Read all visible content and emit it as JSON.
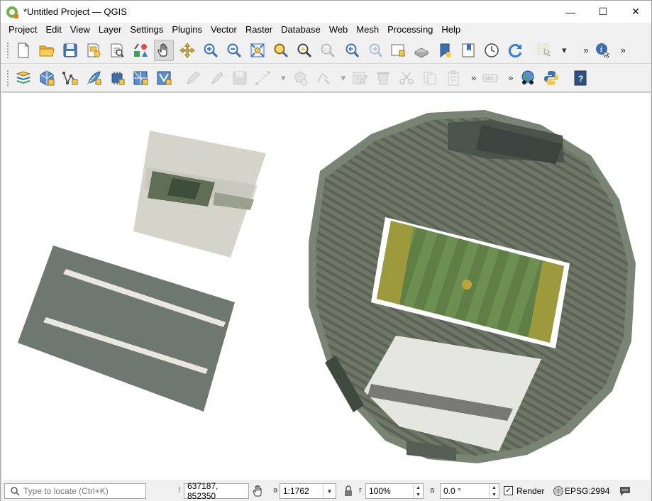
{
  "window": {
    "title": "*Untitled Project — QGIS",
    "controls": {
      "minimize": "—",
      "maximize": "☐",
      "close": "✕"
    }
  },
  "menu": [
    "Project",
    "Edit",
    "View",
    "Layer",
    "Settings",
    "Plugins",
    "Vector",
    "Raster",
    "Database",
    "Web",
    "Mesh",
    "Processing",
    "Help"
  ],
  "toolbar1": {
    "tools": [
      "new-project",
      "open-project",
      "save-project",
      "print-layout",
      "layout-manager",
      "style-manager",
      "pan",
      "pan-to-selection",
      "zoom-in",
      "zoom-out",
      "zoom-full",
      "zoom-to-selection",
      "zoom-to-layer",
      "zoom-native",
      "zoom-last",
      "zoom-next",
      "new-bookmark",
      "show-bookmarks",
      "temporal-controller",
      "refresh",
      "select-features",
      "identify"
    ],
    "active": "pan",
    "overflow": "»"
  },
  "toolbar2": {
    "tools": [
      "data-source-manager",
      "new-geopackage-layer",
      "new-shapefile-layer",
      "new-spatialite-layer",
      "new-virtual-layer",
      "new-temporary-scratch-layer",
      "new-vector-tile-layer",
      "toggle-editing",
      "current-edits",
      "save-edits",
      "digitize",
      "vertex-tool",
      "delete-selected",
      "cut-features",
      "copy-features",
      "paste-features",
      "label-tool",
      "plugins-globe",
      "python-console",
      "help"
    ],
    "overflow": "»"
  },
  "map": {
    "features": [
      "parking-lot-north",
      "parking-lot-south",
      "stadium"
    ]
  },
  "statusbar": {
    "locator_placeholder": "Type to locate (Ctrl+K)",
    "coordinate_label": "Coordinate",
    "coordinate": "637187, 852350",
    "scale_label": "Scale",
    "scale": "1:1762",
    "magnifier_label": "Magnifier",
    "magnifier": "100%",
    "rotation_label": "Rotation",
    "rotation": "0.0 °",
    "render_label": "Render",
    "render_checked": true,
    "crs": "EPSG:2994"
  }
}
